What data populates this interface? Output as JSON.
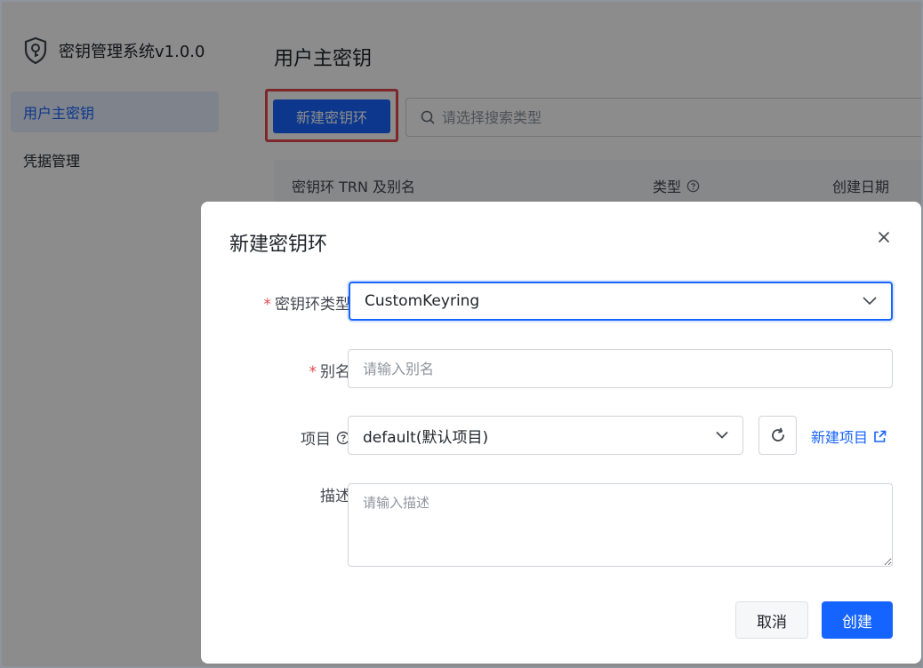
{
  "app": {
    "title": "密钥管理系统v1.0.0"
  },
  "sidebar": {
    "items": [
      {
        "label": "用户主密钥",
        "active": true
      },
      {
        "label": "凭据管理",
        "active": false
      }
    ]
  },
  "main": {
    "title": "用户主密钥",
    "create_button": "新建密钥环",
    "search": {
      "placeholder": "请选择搜索类型"
    },
    "table": {
      "columns": [
        "密钥环 TRN 及别名",
        "类型",
        "创建日期"
      ]
    }
  },
  "modal": {
    "title": "新建密钥环",
    "fields": {
      "keyring_type": {
        "label": "密钥环类型",
        "required": true,
        "value": "CustomKeyring"
      },
      "alias": {
        "label": "别名",
        "required": true,
        "placeholder": "请输入别名"
      },
      "project": {
        "label": "项目",
        "value": "default(默认项目)",
        "new_link": "新建项目"
      },
      "description": {
        "label": "描述",
        "placeholder": "请输入描述"
      }
    },
    "cancel_label": "取消",
    "ok_label": "创建"
  },
  "colors": {
    "primary": "#1664ff",
    "required": "#e5484d",
    "highlight": "#e5484d"
  }
}
